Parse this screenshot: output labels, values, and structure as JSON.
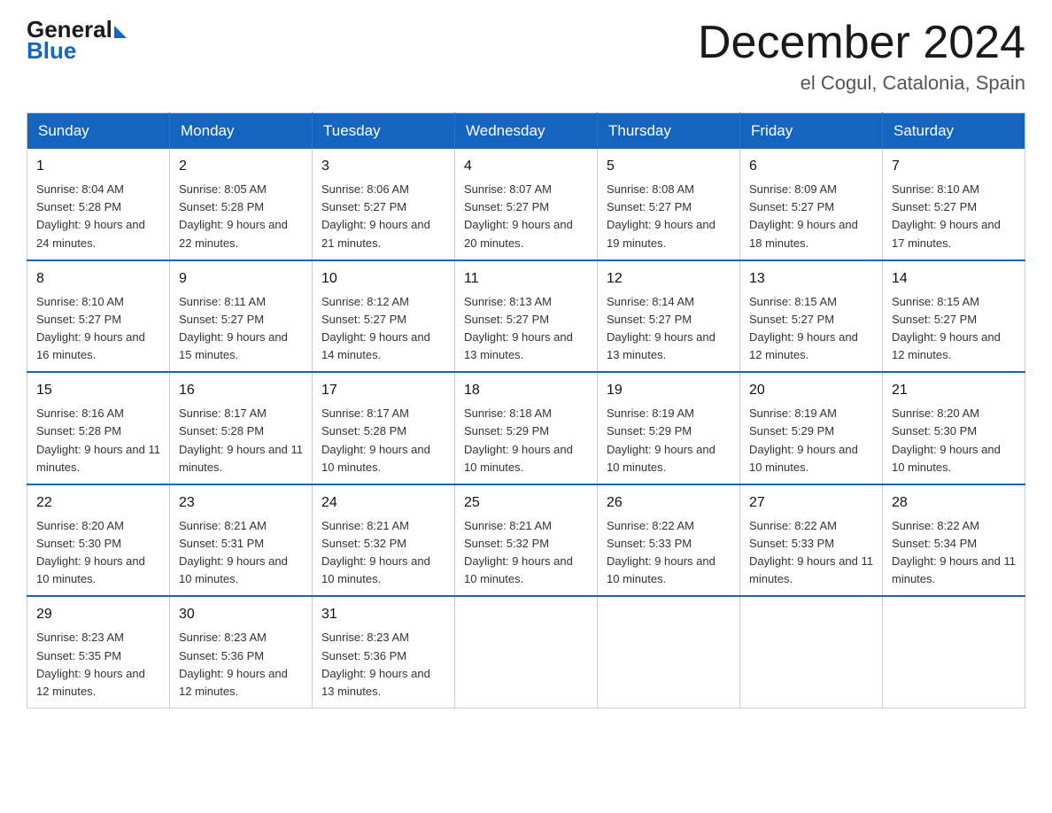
{
  "header": {
    "logo_general": "General",
    "logo_blue": "Blue",
    "month_title": "December 2024",
    "location": "el Cogul, Catalonia, Spain"
  },
  "weekdays": [
    "Sunday",
    "Monday",
    "Tuesday",
    "Wednesday",
    "Thursday",
    "Friday",
    "Saturday"
  ],
  "weeks": [
    [
      {
        "day": "1",
        "sunrise": "Sunrise: 8:04 AM",
        "sunset": "Sunset: 5:28 PM",
        "daylight": "Daylight: 9 hours and 24 minutes."
      },
      {
        "day": "2",
        "sunrise": "Sunrise: 8:05 AM",
        "sunset": "Sunset: 5:28 PM",
        "daylight": "Daylight: 9 hours and 22 minutes."
      },
      {
        "day": "3",
        "sunrise": "Sunrise: 8:06 AM",
        "sunset": "Sunset: 5:27 PM",
        "daylight": "Daylight: 9 hours and 21 minutes."
      },
      {
        "day": "4",
        "sunrise": "Sunrise: 8:07 AM",
        "sunset": "Sunset: 5:27 PM",
        "daylight": "Daylight: 9 hours and 20 minutes."
      },
      {
        "day": "5",
        "sunrise": "Sunrise: 8:08 AM",
        "sunset": "Sunset: 5:27 PM",
        "daylight": "Daylight: 9 hours and 19 minutes."
      },
      {
        "day": "6",
        "sunrise": "Sunrise: 8:09 AM",
        "sunset": "Sunset: 5:27 PM",
        "daylight": "Daylight: 9 hours and 18 minutes."
      },
      {
        "day": "7",
        "sunrise": "Sunrise: 8:10 AM",
        "sunset": "Sunset: 5:27 PM",
        "daylight": "Daylight: 9 hours and 17 minutes."
      }
    ],
    [
      {
        "day": "8",
        "sunrise": "Sunrise: 8:10 AM",
        "sunset": "Sunset: 5:27 PM",
        "daylight": "Daylight: 9 hours and 16 minutes."
      },
      {
        "day": "9",
        "sunrise": "Sunrise: 8:11 AM",
        "sunset": "Sunset: 5:27 PM",
        "daylight": "Daylight: 9 hours and 15 minutes."
      },
      {
        "day": "10",
        "sunrise": "Sunrise: 8:12 AM",
        "sunset": "Sunset: 5:27 PM",
        "daylight": "Daylight: 9 hours and 14 minutes."
      },
      {
        "day": "11",
        "sunrise": "Sunrise: 8:13 AM",
        "sunset": "Sunset: 5:27 PM",
        "daylight": "Daylight: 9 hours and 13 minutes."
      },
      {
        "day": "12",
        "sunrise": "Sunrise: 8:14 AM",
        "sunset": "Sunset: 5:27 PM",
        "daylight": "Daylight: 9 hours and 13 minutes."
      },
      {
        "day": "13",
        "sunrise": "Sunrise: 8:15 AM",
        "sunset": "Sunset: 5:27 PM",
        "daylight": "Daylight: 9 hours and 12 minutes."
      },
      {
        "day": "14",
        "sunrise": "Sunrise: 8:15 AM",
        "sunset": "Sunset: 5:27 PM",
        "daylight": "Daylight: 9 hours and 12 minutes."
      }
    ],
    [
      {
        "day": "15",
        "sunrise": "Sunrise: 8:16 AM",
        "sunset": "Sunset: 5:28 PM",
        "daylight": "Daylight: 9 hours and 11 minutes."
      },
      {
        "day": "16",
        "sunrise": "Sunrise: 8:17 AM",
        "sunset": "Sunset: 5:28 PM",
        "daylight": "Daylight: 9 hours and 11 minutes."
      },
      {
        "day": "17",
        "sunrise": "Sunrise: 8:17 AM",
        "sunset": "Sunset: 5:28 PM",
        "daylight": "Daylight: 9 hours and 10 minutes."
      },
      {
        "day": "18",
        "sunrise": "Sunrise: 8:18 AM",
        "sunset": "Sunset: 5:29 PM",
        "daylight": "Daylight: 9 hours and 10 minutes."
      },
      {
        "day": "19",
        "sunrise": "Sunrise: 8:19 AM",
        "sunset": "Sunset: 5:29 PM",
        "daylight": "Daylight: 9 hours and 10 minutes."
      },
      {
        "day": "20",
        "sunrise": "Sunrise: 8:19 AM",
        "sunset": "Sunset: 5:29 PM",
        "daylight": "Daylight: 9 hours and 10 minutes."
      },
      {
        "day": "21",
        "sunrise": "Sunrise: 8:20 AM",
        "sunset": "Sunset: 5:30 PM",
        "daylight": "Daylight: 9 hours and 10 minutes."
      }
    ],
    [
      {
        "day": "22",
        "sunrise": "Sunrise: 8:20 AM",
        "sunset": "Sunset: 5:30 PM",
        "daylight": "Daylight: 9 hours and 10 minutes."
      },
      {
        "day": "23",
        "sunrise": "Sunrise: 8:21 AM",
        "sunset": "Sunset: 5:31 PM",
        "daylight": "Daylight: 9 hours and 10 minutes."
      },
      {
        "day": "24",
        "sunrise": "Sunrise: 8:21 AM",
        "sunset": "Sunset: 5:32 PM",
        "daylight": "Daylight: 9 hours and 10 minutes."
      },
      {
        "day": "25",
        "sunrise": "Sunrise: 8:21 AM",
        "sunset": "Sunset: 5:32 PM",
        "daylight": "Daylight: 9 hours and 10 minutes."
      },
      {
        "day": "26",
        "sunrise": "Sunrise: 8:22 AM",
        "sunset": "Sunset: 5:33 PM",
        "daylight": "Daylight: 9 hours and 10 minutes."
      },
      {
        "day": "27",
        "sunrise": "Sunrise: 8:22 AM",
        "sunset": "Sunset: 5:33 PM",
        "daylight": "Daylight: 9 hours and 11 minutes."
      },
      {
        "day": "28",
        "sunrise": "Sunrise: 8:22 AM",
        "sunset": "Sunset: 5:34 PM",
        "daylight": "Daylight: 9 hours and 11 minutes."
      }
    ],
    [
      {
        "day": "29",
        "sunrise": "Sunrise: 8:23 AM",
        "sunset": "Sunset: 5:35 PM",
        "daylight": "Daylight: 9 hours and 12 minutes."
      },
      {
        "day": "30",
        "sunrise": "Sunrise: 8:23 AM",
        "sunset": "Sunset: 5:36 PM",
        "daylight": "Daylight: 9 hours and 12 minutes."
      },
      {
        "day": "31",
        "sunrise": "Sunrise: 8:23 AM",
        "sunset": "Sunset: 5:36 PM",
        "daylight": "Daylight: 9 hours and 13 minutes."
      },
      null,
      null,
      null,
      null
    ]
  ]
}
